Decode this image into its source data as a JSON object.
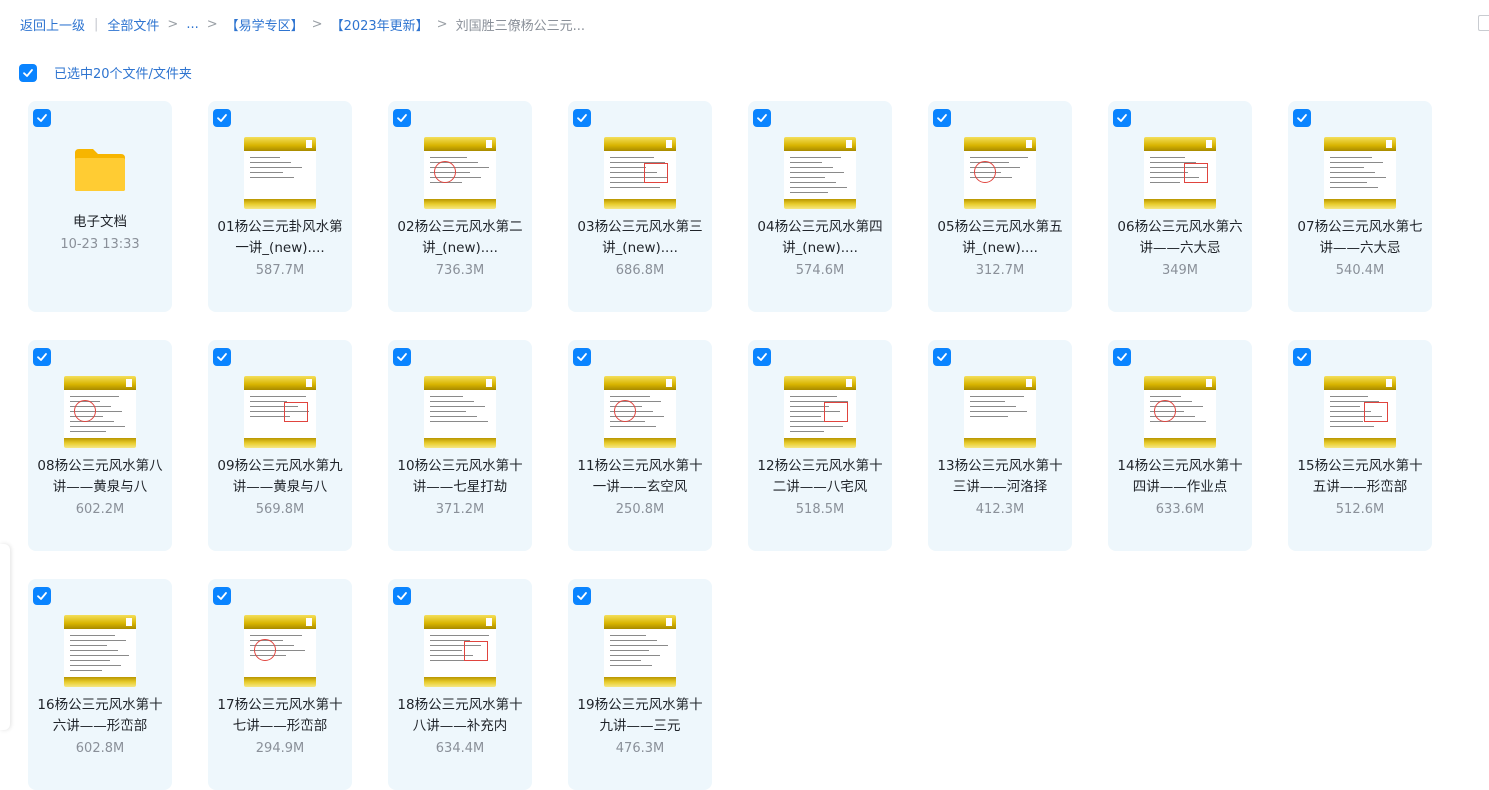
{
  "breadcrumb": {
    "back": "返回上一级",
    "all_files": "全部文件",
    "ellipsis": "...",
    "folder1": "【易学专区】",
    "folder2": "【2023年更新】",
    "current": "刘国胜三僚杨公三元..."
  },
  "selection": {
    "label": "已选中20个文件/文件夹"
  },
  "colors": {
    "accent": "#0a84ff",
    "link": "#2e74d0",
    "card_bg": "#eef7fc"
  },
  "folder": {
    "name": "电子文档",
    "date": "10-23 13:33",
    "icon": "folder-icon"
  },
  "files": [
    {
      "name": "01杨公三元卦风水第一讲_(new)....",
      "size": "587.7M"
    },
    {
      "name": "02杨公三元风水第二讲_(new)....",
      "size": "736.3M"
    },
    {
      "name": "03杨公三元风水第三讲_(new)....",
      "size": "686.8M"
    },
    {
      "name": "04杨公三元风水第四讲_(new)....",
      "size": "574.6M"
    },
    {
      "name": "05杨公三元风水第五讲_(new)....",
      "size": "312.7M"
    },
    {
      "name": "06杨公三元风水第六讲——六大忌",
      "size": "349M"
    },
    {
      "name": "07杨公三元风水第七讲——六大忌",
      "size": "540.4M"
    },
    {
      "name": "08杨公三元风水第八讲——黄泉与八",
      "size": "602.2M"
    },
    {
      "name": "09杨公三元风水第九讲——黄泉与八",
      "size": "569.8M"
    },
    {
      "name": "10杨公三元风水第十讲——七星打劫",
      "size": "371.2M"
    },
    {
      "name": "11杨公三元风水第十一讲——玄空风",
      "size": "250.8M"
    },
    {
      "name": "12杨公三元风水第十二讲——八宅风",
      "size": "518.5M"
    },
    {
      "name": "13杨公三元风水第十三讲——河洛择",
      "size": "412.3M"
    },
    {
      "name": "14杨公三元风水第十四讲——作业点",
      "size": "633.6M"
    },
    {
      "name": "15杨公三元风水第十五讲——形峦部",
      "size": "512.6M"
    },
    {
      "name": "16杨公三元风水第十六讲——形峦部",
      "size": "602.8M"
    },
    {
      "name": "17杨公三元风水第十七讲——形峦部",
      "size": "294.9M"
    },
    {
      "name": "18杨公三元风水第十八讲——补充内",
      "size": "634.4M"
    },
    {
      "name": "19杨公三元风水第十九讲——三元",
      "size": "476.3M"
    }
  ]
}
